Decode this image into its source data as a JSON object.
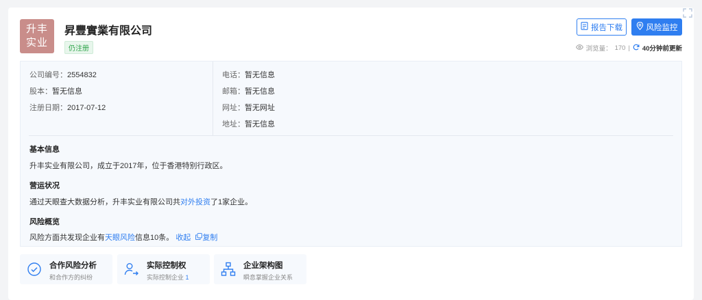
{
  "logo": {
    "line1": "升丰",
    "line2": "实业"
  },
  "company": {
    "name": "昇豐實業有限公司",
    "status": "仍注册"
  },
  "actions": {
    "report_label": "报告下载",
    "monitor_label": "风险监控"
  },
  "meta": {
    "views_label": "浏览量：",
    "views": "170",
    "sep": "|",
    "updated": "40分钟前更新"
  },
  "info": {
    "left": [
      {
        "label": "公司编号：",
        "value": "2554832"
      },
      {
        "label": "股本：",
        "value": "暂无信息"
      },
      {
        "label": "注册日期：",
        "value": "2017-07-12"
      }
    ],
    "right": [
      {
        "label": "电话：",
        "value": "暂无信息"
      },
      {
        "label": "邮箱：",
        "value": "暂无信息"
      },
      {
        "label": "网址：",
        "value": "暂无网址"
      },
      {
        "label": "地址：",
        "value": "暂无信息"
      }
    ]
  },
  "basic": {
    "title": "基本信息",
    "text": "升丰实业有限公司，成立于2017年，位于香港特别行政区。"
  },
  "operation": {
    "title": "营运状况",
    "text_before": "通过天眼查大数据分析，升丰实业有限公司共",
    "link": "对外投资",
    "text_after": "了1家企业。"
  },
  "risk": {
    "title": "风险概览",
    "text_before": "风险方面共发现企业有",
    "link": "天眼风险",
    "text_after": "信息10条。",
    "collapse": "收起",
    "copy": "复制"
  },
  "features": [
    {
      "title": "合作风险分析",
      "sub": "和合作方的纠纷",
      "num": ""
    },
    {
      "title": "实际控制权",
      "sub": "实际控制企业 ",
      "num": "1"
    },
    {
      "title": "企业架构图",
      "sub": "瞬息掌握企业关系",
      "num": ""
    }
  ],
  "icons": {
    "report": "document-icon",
    "monitor": "location-pin-icon",
    "views": "eye-icon",
    "refresh": "refresh-icon",
    "copy": "copy-icon",
    "f1": "risk-shield-icon",
    "f2": "person-arrow-icon",
    "f3": "org-chart-icon"
  },
  "colors": {
    "accent": "#2f7ef0",
    "logo_bg": "#c98d8a",
    "status_green": "#2fa44a"
  }
}
